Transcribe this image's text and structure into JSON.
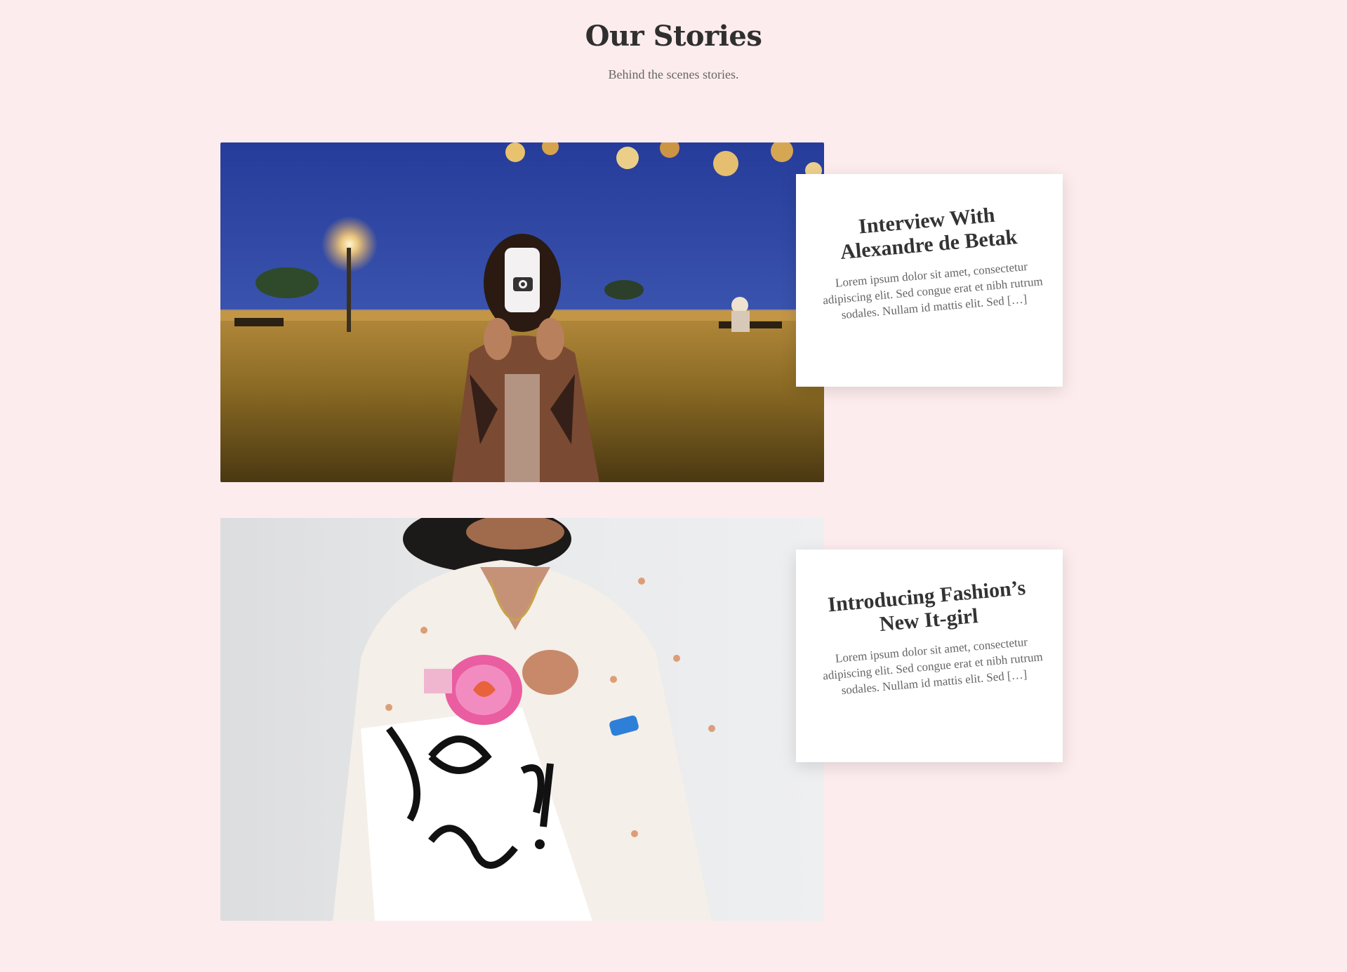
{
  "section": {
    "title": "Our Stories",
    "subtitle": "Behind the scenes stories."
  },
  "stories": [
    {
      "title": "Interview With Alexandre de Betak",
      "excerpt": "Lorem ipsum dolor sit amet, consectetur adipiscing elit. Sed congue erat et nibh rutrum sodales. Nullam id mattis elit. Sed […]",
      "image_alt": "Woman holding a phone in front of her face in a park at night"
    },
    {
      "title": "Introducing Fashion’s New It-girl",
      "excerpt": "Lorem ipsum dolor sit amet, consectetur adipiscing elit. Sed congue erat et nibh rutrum sodales. Nullam id mattis elit. Sed […]",
      "image_alt": "Woman putting a pink tin into a printed tote bag"
    }
  ],
  "colors": {
    "background": "#fdeced",
    "card": "#ffffff",
    "heading": "#2f2f2f",
    "body_text": "#666666"
  }
}
